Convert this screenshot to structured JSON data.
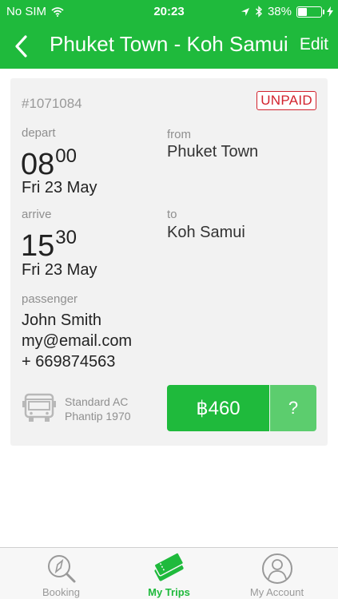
{
  "status_bar": {
    "carrier": "No SIM",
    "time": "20:23",
    "battery_text": "38%",
    "battery_level": 0.38
  },
  "nav": {
    "back_icon": "chevron-left-icon",
    "title": "Phuket Town - Koh Samui",
    "edit_label": "Edit"
  },
  "ticket": {
    "booking_id": "#1071084",
    "status": "UNPAID",
    "depart": {
      "label": "depart",
      "hour": "08",
      "minute": "00",
      "date": "Fri 23 May"
    },
    "from": {
      "label": "from",
      "place": "Phuket Town"
    },
    "arrive": {
      "label": "arrive",
      "hour": "15",
      "minute": "30",
      "date": "Fri 23 May"
    },
    "to": {
      "label": "to",
      "place": "Koh Samui"
    },
    "passenger": {
      "label": "passenger",
      "name": "John Smith",
      "email": "my@email.com",
      "phone": "+ 669874563"
    },
    "vehicle": {
      "icon": "bus-icon",
      "class_line1": "Standard AC",
      "class_line2": "Phantip 1970"
    },
    "price": "฿460",
    "help_label": "?"
  },
  "tabs": [
    {
      "label": "Booking",
      "icon": "compass-search-icon",
      "active": false
    },
    {
      "label": "My Trips",
      "icon": "tickets-icon",
      "active": true
    },
    {
      "label": "My Account",
      "icon": "user-icon",
      "active": false
    }
  ],
  "colors": {
    "brand_green": "#1fba3c",
    "help_green": "#5ccd6e",
    "unpaid_red": "#d2222d",
    "inactive_gray": "#999999"
  }
}
